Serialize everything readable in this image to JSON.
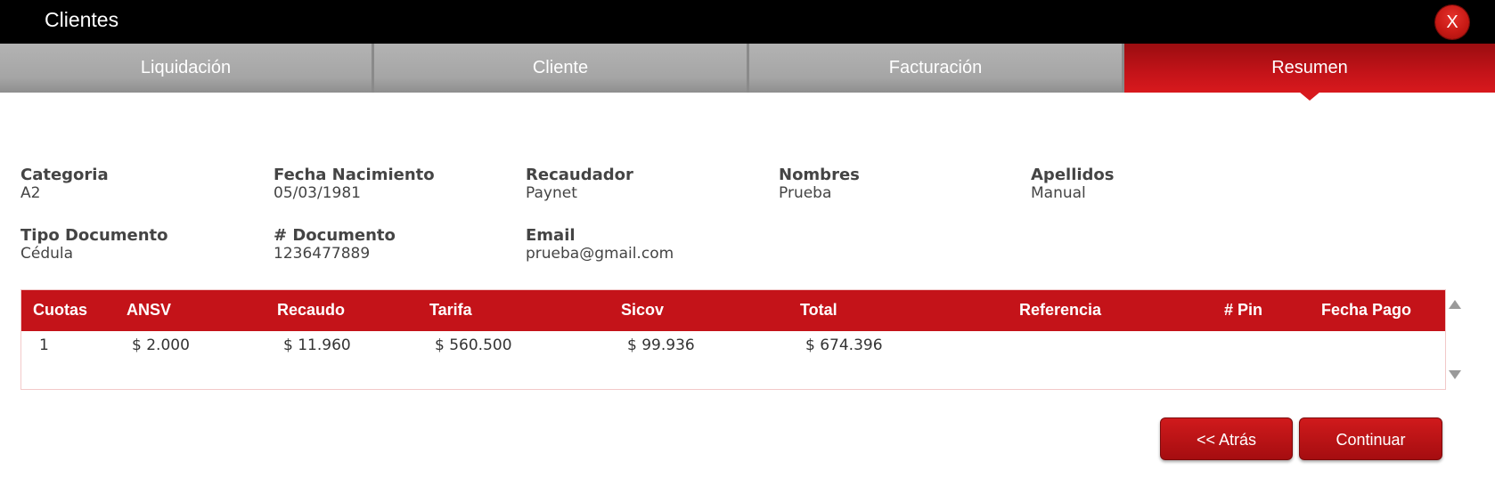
{
  "window": {
    "title": "Clientes",
    "close_label": "X"
  },
  "tabs": [
    {
      "label": "Liquidación"
    },
    {
      "label": "Cliente"
    },
    {
      "label": "Facturación"
    },
    {
      "label": "Resumen",
      "active": true
    }
  ],
  "summary": {
    "categoria": {
      "label": "Categoria",
      "value": "A2"
    },
    "fecha_nacimiento": {
      "label": "Fecha Nacimiento",
      "value": "05/03/1981"
    },
    "recaudador": {
      "label": "Recaudador",
      "value": "Paynet"
    },
    "nombres": {
      "label": "Nombres",
      "value": "Prueba"
    },
    "apellidos": {
      "label": "Apellidos",
      "value": "Manual"
    },
    "tipo_documento": {
      "label": "Tipo Documento",
      "value": "Cédula"
    },
    "documento": {
      "label": "# Documento",
      "value": "1236477889"
    },
    "email": {
      "label": "Email",
      "value": "prueba@gmail.com"
    }
  },
  "table": {
    "columns": [
      "Cuotas",
      "ANSV",
      "Recaudo",
      "Tarifa",
      "Sicov",
      "Total",
      "Referencia",
      "# Pin",
      "Fecha Pago"
    ],
    "rows": [
      [
        "1",
        "$ 2.000",
        "$ 11.960",
        "$ 560.500",
        "$ 99.936",
        "$ 674.396",
        "",
        "",
        ""
      ]
    ]
  },
  "buttons": {
    "back": "<< Atrás",
    "continue": "Continuar"
  },
  "colors": {
    "accent": "#c41319",
    "titlebar": "#000000",
    "tab_inactive": "#a9a9a9"
  }
}
